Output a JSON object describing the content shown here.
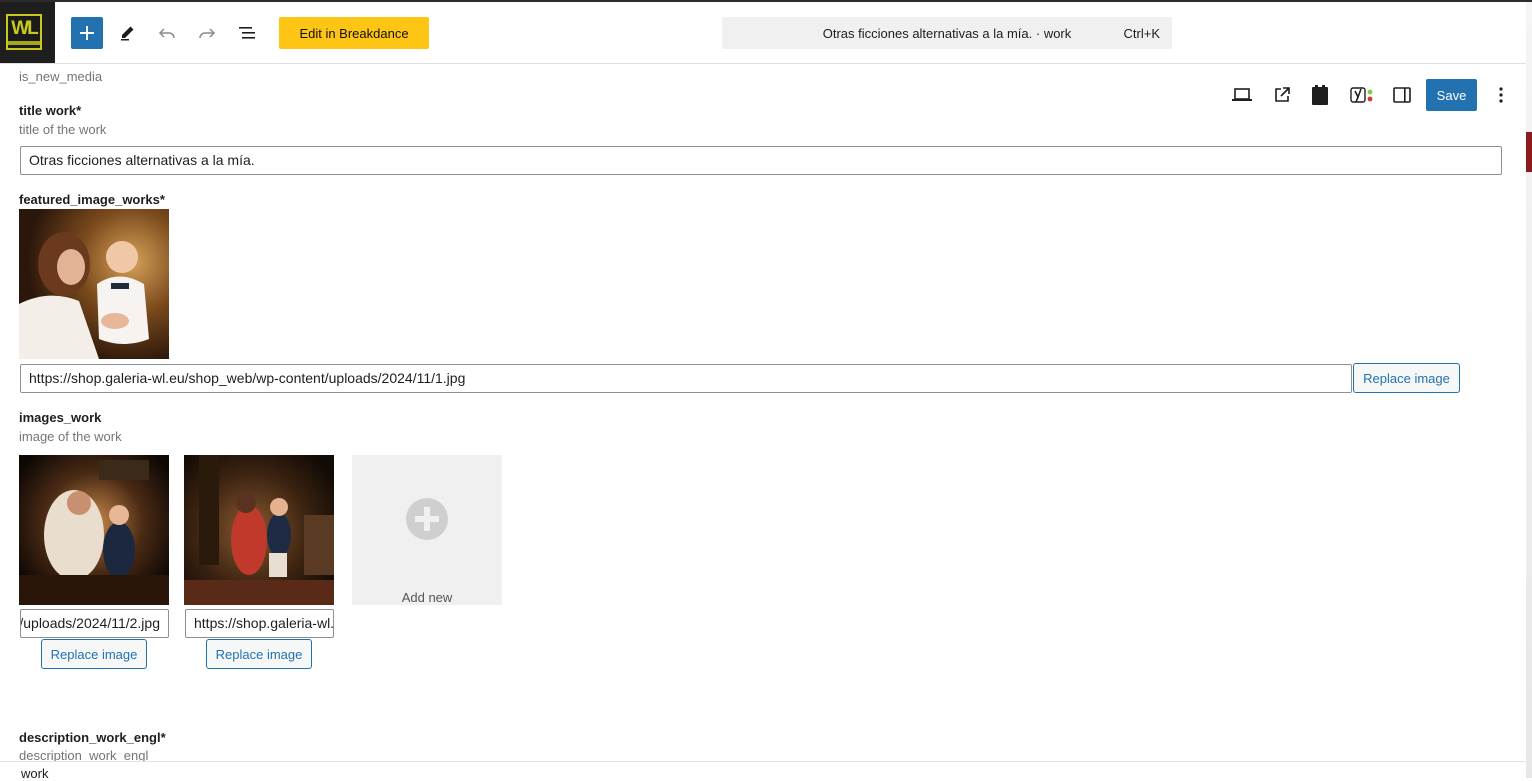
{
  "header": {
    "breakdance_label": "Edit in Breakdance",
    "command_title": "Otras ficciones alternativas a la mía. · work",
    "command_shortcut": "Ctrl+K"
  },
  "actions": {
    "save_label": "Save"
  },
  "fields": {
    "partial_hint": "is_new_media",
    "title": {
      "label": "title work*",
      "hint": "title of the work",
      "value": "Otras ficciones alternativas a la mía."
    },
    "featured": {
      "label": "featured_image_works*",
      "url": "https://shop.galeria-wl.eu/shop_web/wp-content/uploads/2024/11/1.jpg",
      "replace_label": "Replace image"
    },
    "images": {
      "label": "images_work",
      "hint": "image of the work",
      "items": [
        {
          "url": "https://shop.galeria-wl.eu/shop_web/wp-content/uploads/2024/11/2.jpg",
          "replace_label": "Replace image"
        },
        {
          "url": "https://shop.galeria-wl.eu/shop_web/wp-content/uploads/2024/11/3.jpg",
          "replace_label": "Replace image"
        }
      ],
      "add_new_label": "Add new"
    },
    "description": {
      "label": "description_work_engl*",
      "hint": "description_work_engl"
    }
  },
  "footer": {
    "breadcrumb": "work"
  },
  "colors": {
    "accent": "#2271b1",
    "breakdance": "#ffc514",
    "logo": "#c7c91f"
  }
}
